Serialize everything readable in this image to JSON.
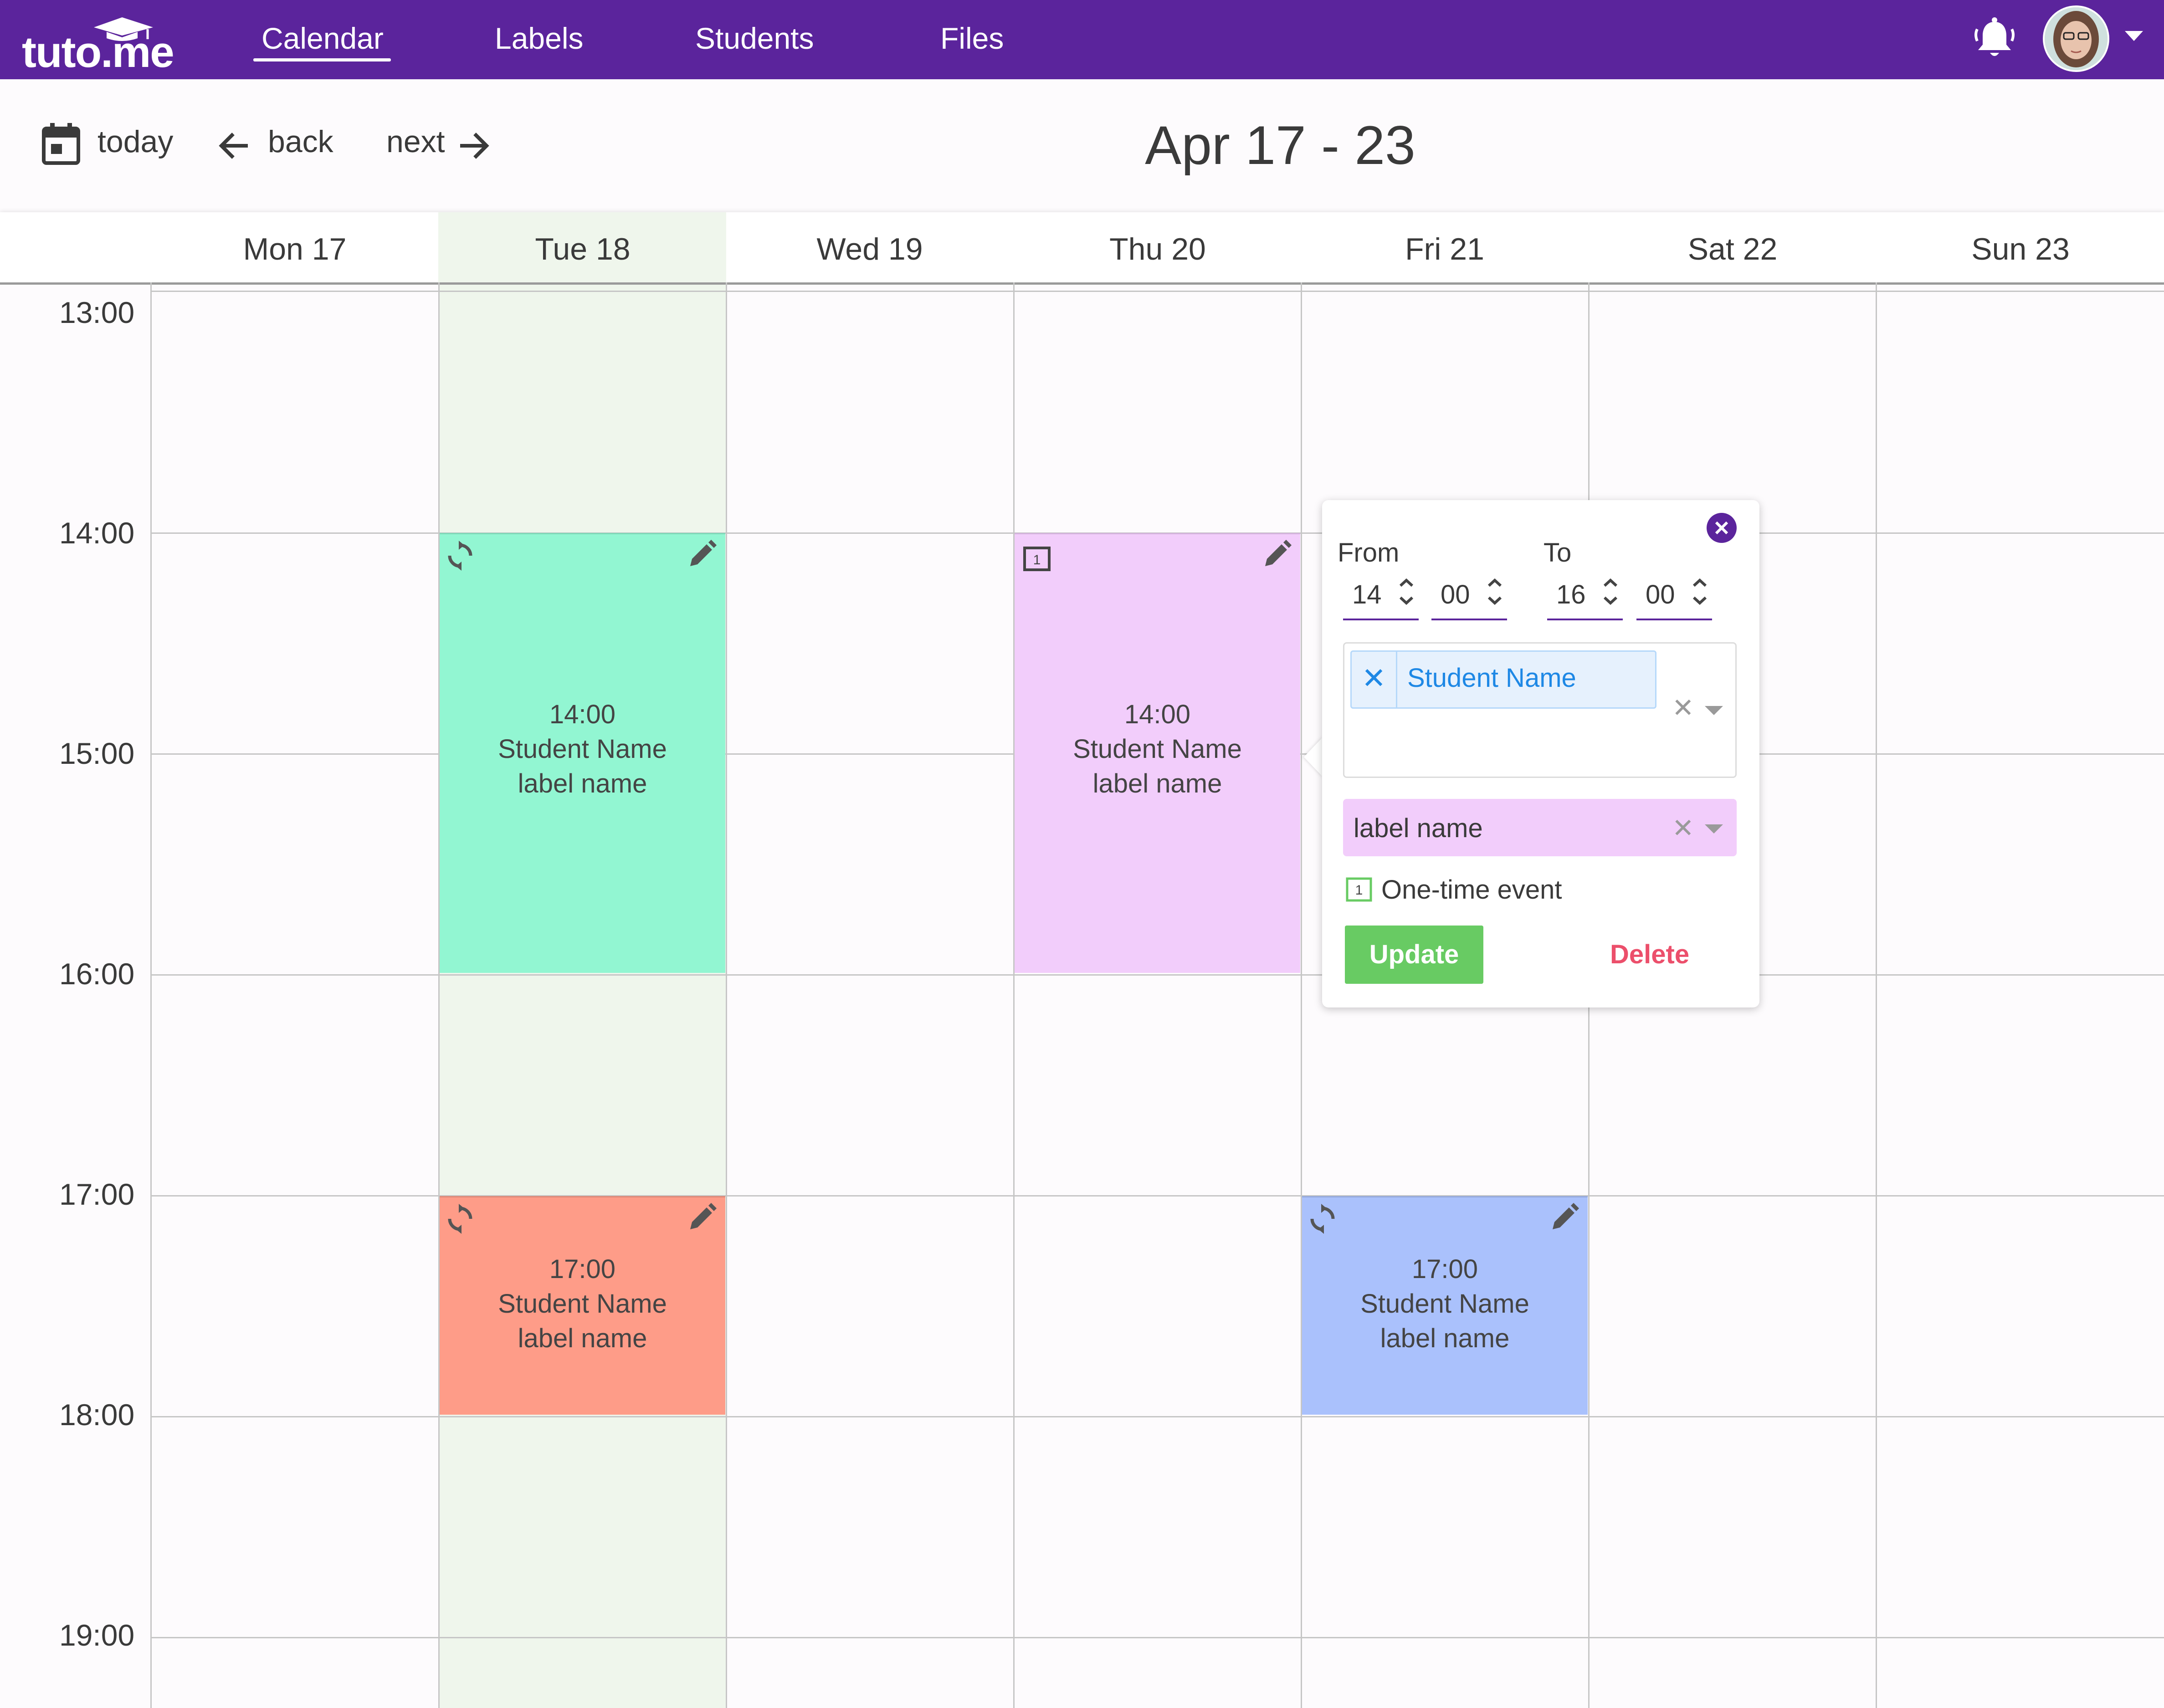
{
  "app": {
    "logo_text": "tuto.me"
  },
  "nav": {
    "items": [
      {
        "label": "Calendar",
        "active": true
      },
      {
        "label": "Labels",
        "active": false
      },
      {
        "label": "Students",
        "active": false
      },
      {
        "label": "Files",
        "active": false
      }
    ],
    "notification_icon": "bell-icon",
    "profile_icon": "avatar",
    "menu_icon": "caret-down-icon"
  },
  "toolbar": {
    "today_label": "today",
    "back_label": "back",
    "next_label": "next",
    "week_title": "Apr 17 - 23"
  },
  "calendar": {
    "days": [
      "Mon 17",
      "Tue 18",
      "Wed 19",
      "Thu 20",
      "Fri 21",
      "Sat 22",
      "Sun 23"
    ],
    "today_index": 1,
    "hours": [
      "13:00",
      "14:00",
      "15:00",
      "16:00",
      "17:00",
      "18:00",
      "19:00"
    ],
    "events": [
      {
        "day": "Tue 18",
        "time": "14:00",
        "student": "Student Name",
        "label": "label name",
        "color": "#92f6d2",
        "type_icon": "recurring-icon"
      },
      {
        "day": "Thu 20",
        "time": "14:00",
        "student": "Student Name",
        "label": "label name",
        "color": "#f2cdfb",
        "type_icon": "one-time-icon"
      },
      {
        "day": "Tue 18",
        "time": "17:00",
        "student": "Student Name",
        "label": "label name",
        "color": "#fe9c88",
        "type_icon": "recurring-icon"
      },
      {
        "day": "Fri 21",
        "time": "17:00",
        "student": "Student Name",
        "label": "label name",
        "color": "#aac1fc",
        "type_icon": "recurring-icon"
      }
    ]
  },
  "popover": {
    "from_label": "From",
    "to_label": "To",
    "from_hour": "14",
    "from_minute": "00",
    "to_hour": "16",
    "to_minute": "00",
    "student_chip": "Student Name",
    "label_value": "label name",
    "label_color": "#f2cdfb",
    "one_time_label": "One-time event",
    "update_label": "Update",
    "delete_label": "Delete"
  },
  "colors": {
    "brand": "#5b249c",
    "today_column": "#eff6ec",
    "update": "#68cb63",
    "delete": "#ec4f6b",
    "chip_text": "#1e88e5"
  }
}
